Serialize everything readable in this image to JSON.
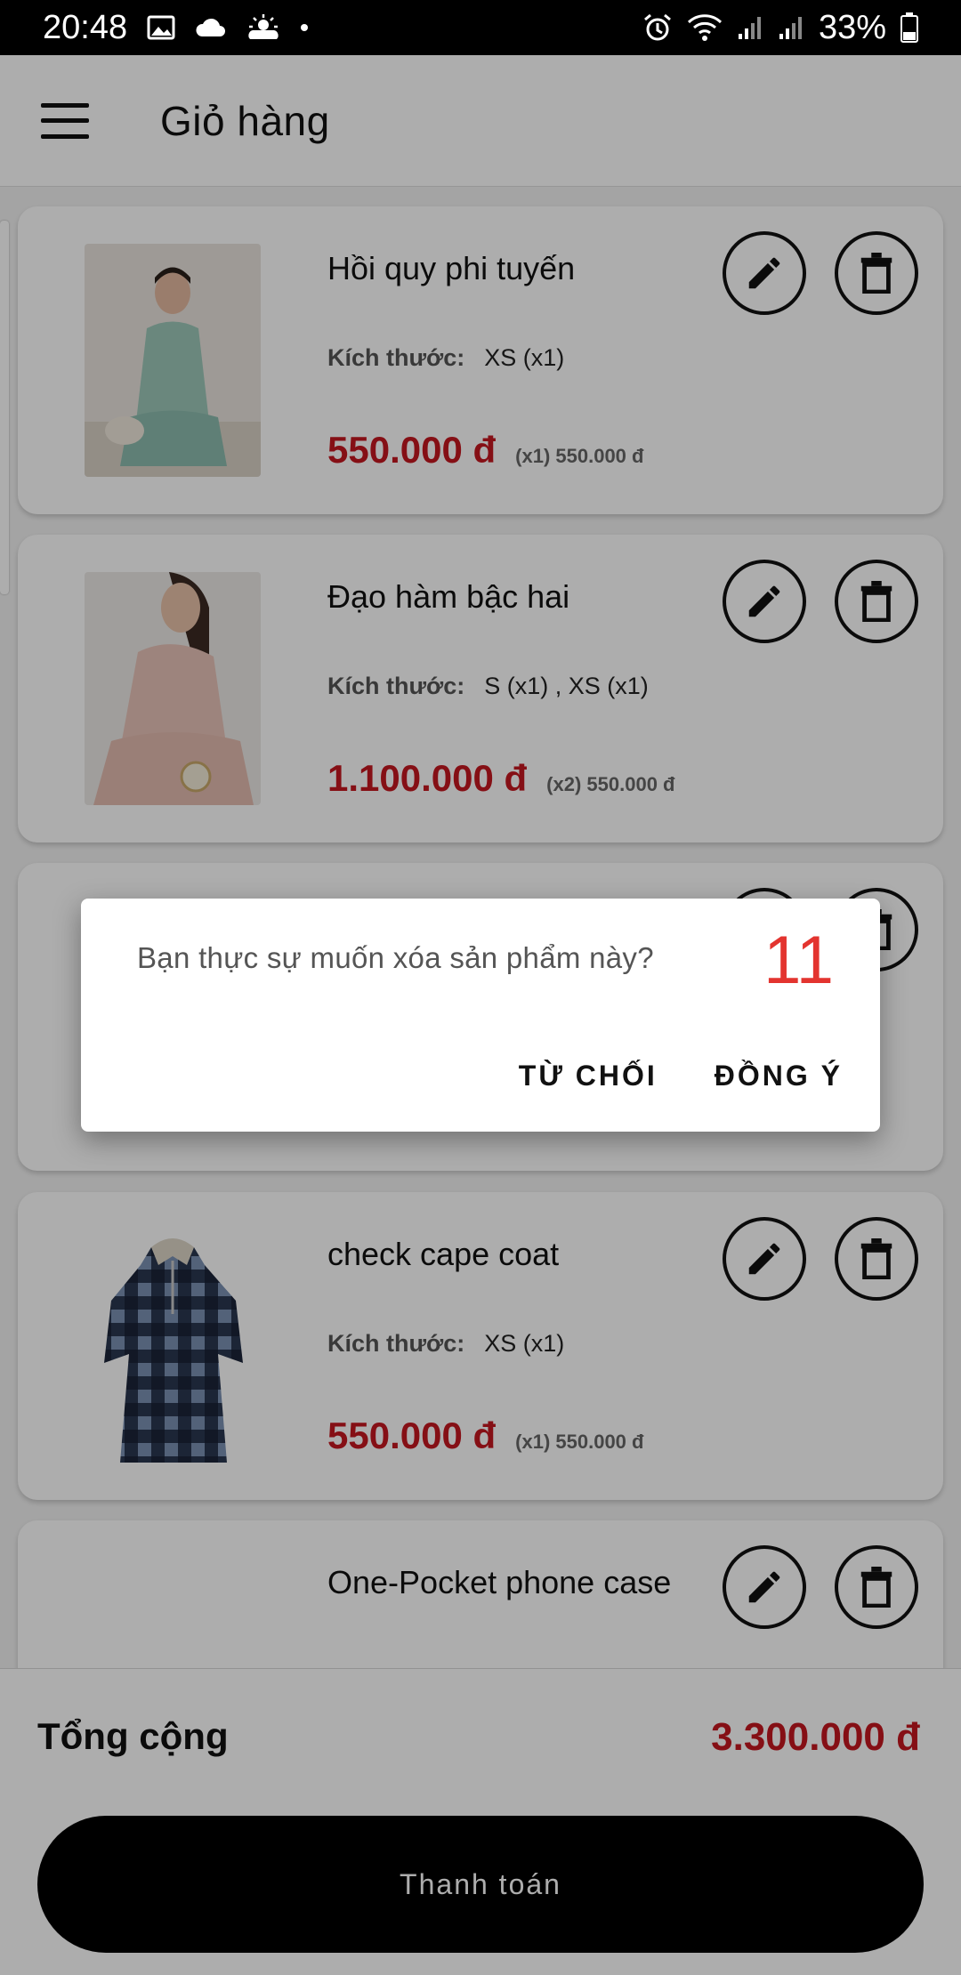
{
  "status_bar": {
    "time": "20:48",
    "battery": "33%",
    "icons": [
      "image-icon",
      "cloud-icon",
      "sun-cloud-icon",
      "dot-icon",
      "alarm-icon",
      "wifi-icon",
      "signal-icon",
      "signal-icon",
      "battery-icon"
    ]
  },
  "appbar": {
    "title": "Giỏ hàng",
    "menu_icon": "hamburger-menu-icon"
  },
  "cart": {
    "size_label": "Kích thước:",
    "items": [
      {
        "name": "Hồi quy phi tuyến",
        "size": "XS (x1)",
        "price": "550.000 đ",
        "sub": "(x1) 550.000 đ"
      },
      {
        "name": "Đạo hàm bậc hai",
        "size": "S (x1) , XS (x1)",
        "price": "1.100.000 đ",
        "sub": "(x2) 550.000 đ"
      },
      {
        "name": "",
        "size": "",
        "price": "",
        "sub": ""
      },
      {
        "name": "check cape coat",
        "size": "XS (x1)",
        "price": "550.000 đ",
        "sub": "(x1) 550.000 đ"
      },
      {
        "name": "One-Pocket phone case",
        "size": "",
        "price": "",
        "sub": ""
      }
    ]
  },
  "summary": {
    "total_label": "Tổng cộng",
    "total_value": "3.300.000 đ",
    "checkout_label": "Thanh toán"
  },
  "dialog": {
    "message": "Bạn thực sự muốn xóa sản phẩm này?",
    "count": "11",
    "decline_label": "TỪ CHỐI",
    "accept_label": "ĐỒNG Ý"
  },
  "colors": {
    "price_red": "#c5171f",
    "counter_red": "#e3342f",
    "button_black": "#000000"
  }
}
